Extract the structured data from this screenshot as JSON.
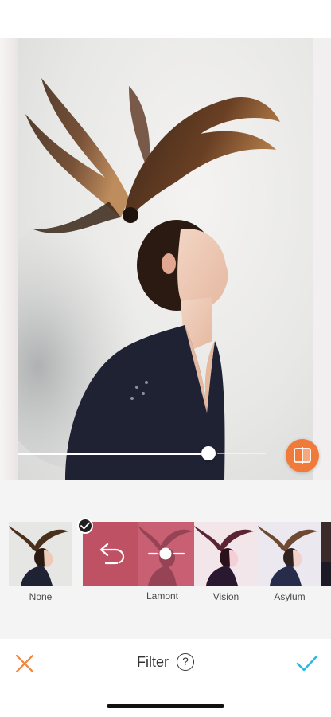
{
  "editor": {
    "title": "Filter",
    "help_symbol": "?",
    "intensity_percent": 77
  },
  "filters": [
    {
      "label": "None",
      "selected": false,
      "tint": "none"
    },
    {
      "label": "Lamont",
      "selected": true,
      "tint": "#c95f73"
    },
    {
      "label": "Vision",
      "selected": false,
      "tint": "warm-pink"
    },
    {
      "label": "Asylum",
      "selected": false,
      "tint": "lavender"
    }
  ],
  "colors": {
    "accent_orange": "#f07a3a",
    "cancel_orange": "#f2843e",
    "confirm_cyan": "#2bb7e4",
    "selected_filter": "#c95f73"
  },
  "icons": {
    "cancel": "close-icon",
    "confirm": "checkmark-icon",
    "compare": "compare-icon",
    "undo": "undo-icon",
    "adjust": "slider-adjust-icon",
    "selected_check": "check-icon",
    "help": "help-icon"
  }
}
